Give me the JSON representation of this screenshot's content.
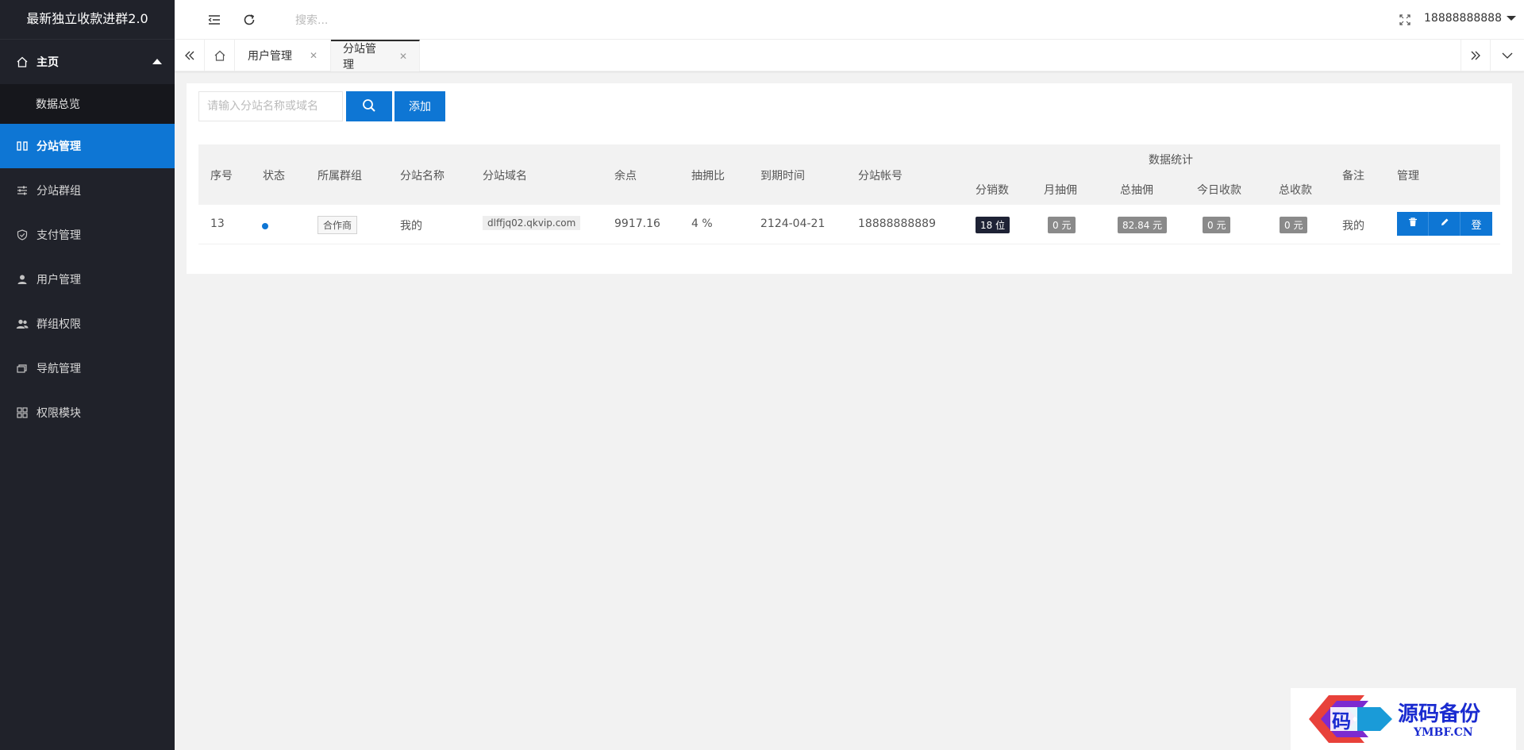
{
  "app": {
    "title": "最新独立收款进群2.0"
  },
  "sidebar": {
    "home": "主页",
    "home_sub": "数据总览",
    "items": [
      {
        "label": "分站管理",
        "icon": "columns-icon",
        "active": true
      },
      {
        "label": "分站群组",
        "icon": "sliders-icon"
      },
      {
        "label": "支付管理",
        "icon": "shield-check-icon"
      },
      {
        "label": "用户管理",
        "icon": "user-icon"
      },
      {
        "label": "群组权限",
        "icon": "users-icon"
      },
      {
        "label": "导航管理",
        "icon": "cards-icon"
      },
      {
        "label": "权限模块",
        "icon": "grid-icon"
      }
    ]
  },
  "header": {
    "search_placeholder": "搜索...",
    "user": "18888888888"
  },
  "tabs": [
    {
      "label": "用户管理",
      "closable": true
    },
    {
      "label": "分站管理",
      "closable": true,
      "active": true
    }
  ],
  "toolbar": {
    "search_placeholder": "请输入分站名称或域名",
    "add_label": "添加"
  },
  "table": {
    "group_header": "数据统计",
    "columns": {
      "index": "序号",
      "status": "状态",
      "group": "所属群组",
      "name": "分站名称",
      "domain": "分站域名",
      "balance": "余点",
      "commission_rate": "抽拥比",
      "expire": "到期时间",
      "account": "分站帐号",
      "distributors": "分销数",
      "monthly_commission": "月抽佣",
      "total_commission": "总抽佣",
      "today_revenue": "今日收款",
      "total_revenue": "总收款",
      "remark": "备注",
      "manage": "管理"
    },
    "rows": [
      {
        "index": "13",
        "group": "合作商",
        "name": "我的",
        "domain": "dlffjq02.qkvip.com",
        "balance": "9917.16",
        "commission_rate": "4 %",
        "expire": "2124-04-21",
        "account": "18888888889",
        "distributors": "18 位",
        "monthly_commission": "0 元",
        "total_commission": "82.84 元",
        "today_revenue": "0 元",
        "total_revenue": "0 元",
        "remark": "我的",
        "login_label": "登"
      }
    ]
  },
  "watermark": {
    "title": "源码备份",
    "subtitle": "YMBF.CN",
    "logo_char": "码"
  },
  "colors": {
    "primary": "#0e76d4",
    "sidebar": "#20222a",
    "dark_badge": "#1e2235"
  }
}
